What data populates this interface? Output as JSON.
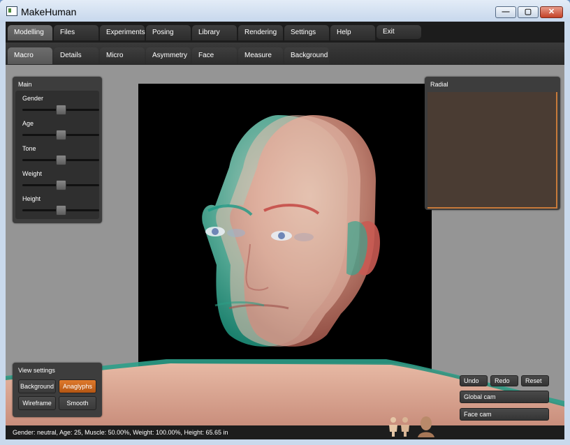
{
  "window": {
    "title": "MakeHuman",
    "minimize_glyph": "—",
    "maximize_glyph": "▢",
    "close_glyph": "✕"
  },
  "menu_tabs": [
    {
      "label": "Modelling",
      "active": true
    },
    {
      "label": "Files"
    },
    {
      "label": "Experiments"
    },
    {
      "label": "Posing"
    },
    {
      "label": "Library"
    },
    {
      "label": "Rendering"
    },
    {
      "label": "Settings"
    },
    {
      "label": "Help"
    },
    {
      "label": "Exit"
    }
  ],
  "sub_tabs": [
    {
      "label": "Macro",
      "active": true
    },
    {
      "label": "Details"
    },
    {
      "label": "Micro"
    },
    {
      "label": "Asymmetry"
    },
    {
      "label": "Face"
    },
    {
      "label": "Measure"
    },
    {
      "label": "Background"
    }
  ],
  "main_panel": {
    "title": "Main",
    "sliders": [
      {
        "label": "Gender",
        "value": 0.5
      },
      {
        "label": "Age",
        "value": 0.5
      },
      {
        "label": "Tone",
        "value": 0.5
      },
      {
        "label": "Weight",
        "value": 0.5
      },
      {
        "label": "Height",
        "value": 0.5
      }
    ]
  },
  "radial_panel": {
    "title": "Radial",
    "accent_color": "#c87a3a"
  },
  "view_settings": {
    "title": "View settings",
    "buttons": [
      {
        "label": "Background",
        "selected": false
      },
      {
        "label": "Anaglyphs",
        "selected": true
      },
      {
        "label": "Wireframe",
        "selected": false
      },
      {
        "label": "Smooth",
        "selected": false
      }
    ]
  },
  "camera_controls": {
    "undo": "Undo",
    "redo": "Redo",
    "reset": "Reset",
    "global_cam": "Global cam",
    "face_cam": "Face cam"
  },
  "status_bar": {
    "text": "Gender: neutral, Age: 25, Muscle: 50.00%, Weight: 100.00%, Height: 65.65 in"
  },
  "icons": {
    "app": "makehuman-app-icon",
    "logo_figures": "human-figures-logo-icon",
    "logo_head": "head-logo-icon"
  }
}
